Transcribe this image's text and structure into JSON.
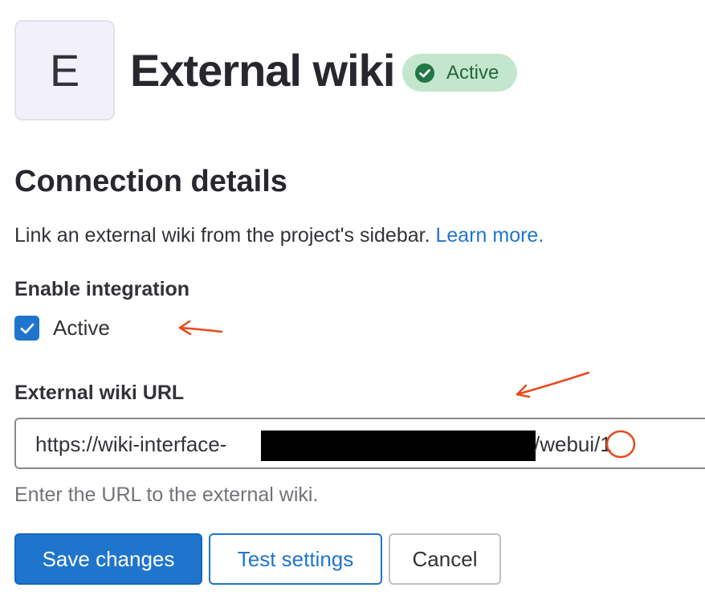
{
  "header": {
    "avatar_letter": "E",
    "title": "External wiki",
    "status_badge": "Active",
    "status_color": "#24663b",
    "badge_background": "#c3e6cd"
  },
  "connection": {
    "section_title": "Connection details",
    "description": "Link an external wiki from the project's sidebar.",
    "learn_more": "Learn more."
  },
  "enable": {
    "label": "Enable integration",
    "checkbox_label": "Active",
    "checked": true
  },
  "url_field": {
    "label": "External wiki URL",
    "value_prefix": "https://wiki-interface-",
    "value_suffix": "/webui/1",
    "help": "Enter the URL to the external wiki."
  },
  "actions": {
    "save_label": "Save changes",
    "test_label": "Test settings",
    "cancel_label": "Cancel"
  },
  "colors": {
    "accent": "#1f75cb",
    "annotation": "#e8491d"
  },
  "icons": {
    "badge": "check-circle-icon",
    "checkbox": "checkmark-icon"
  }
}
